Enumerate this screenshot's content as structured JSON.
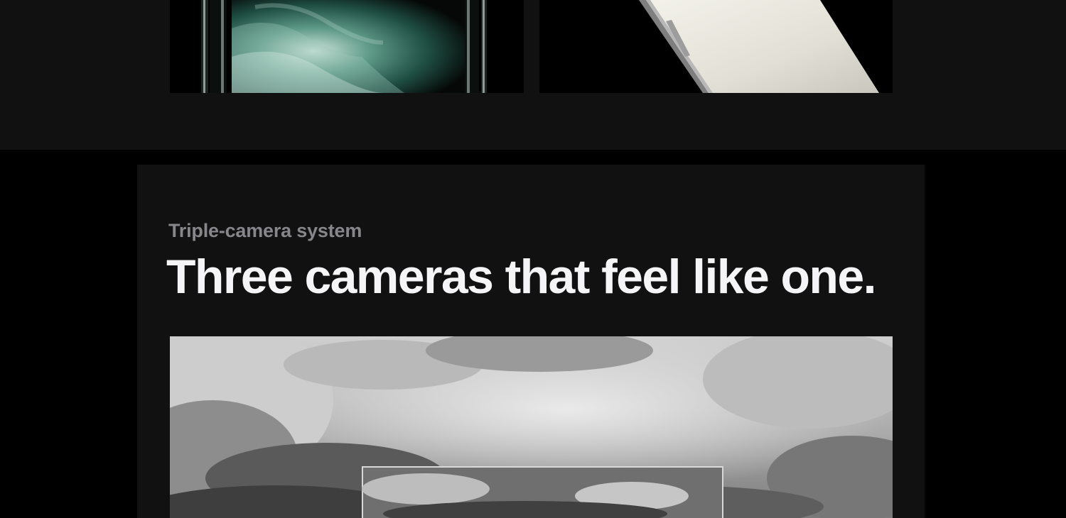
{
  "camera_section": {
    "eyebrow": "Triple-camera system",
    "headline": "Three cameras that feel like one."
  },
  "images": {
    "phone_left": "iPhone front with green wave wallpaper",
    "phone_right": "silver iPhone side view",
    "sky_photo": "black and white cloudy sky photo with zoom frame"
  },
  "colors": {
    "page_background": "#000000",
    "section_background": "#111111",
    "eyebrow_text": "#86868b",
    "headline_text": "#f5f5f7"
  }
}
